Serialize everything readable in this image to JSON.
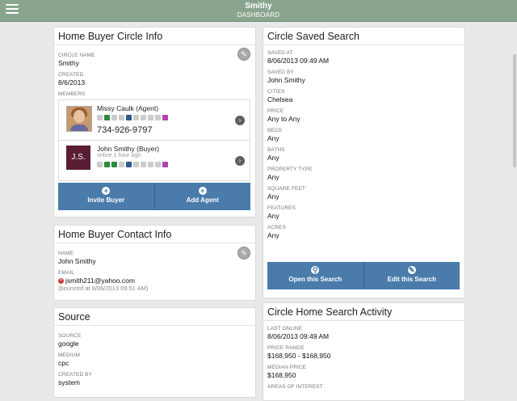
{
  "header": {
    "title": "Smithy",
    "subtitle": "DASHBOARD"
  },
  "circle_info": {
    "heading": "Home Buyer Circle Info",
    "circle_name_label": "CIRCLE NAME",
    "circle_name": "Smithy",
    "created_label": "CREATED",
    "created": "8/6/2013",
    "members_label": "MEMBERS",
    "members": [
      {
        "name": "Missy Caulk (Agent)",
        "phone": "734-926-9797"
      },
      {
        "initials": "J.S.",
        "name": "John Smithy (Buyer)",
        "status": "online 1 hour ago"
      }
    ],
    "invite_label": "Invite Buyer",
    "add_agent_label": "Add Agent"
  },
  "contact_info": {
    "heading": "Home Buyer Contact Info",
    "name_label": "NAME",
    "name": "John Smithy",
    "email_label": "EMAIL",
    "email": "jsmith211@yahoo.com",
    "bounce_note": "(bounced at 8/06/2013 09:51 AM)"
  },
  "source": {
    "heading": "Source",
    "source_label": "SOURCE",
    "source": "google",
    "medium_label": "MEDIUM",
    "medium": "cpc",
    "created_by_label": "CREATED BY",
    "created_by": "system"
  },
  "saved_search": {
    "heading": "Circle Saved Search",
    "fields": [
      {
        "label": "SAVED AT",
        "value": "8/06/2013 09:49 AM"
      },
      {
        "label": "SAVED BY",
        "value": "John Smithy"
      },
      {
        "label": "CITIES",
        "value": "Chelsea"
      },
      {
        "label": "PRICE",
        "value": "Any to Any"
      },
      {
        "label": "BEDS",
        "value": "Any"
      },
      {
        "label": "BATHS",
        "value": "Any"
      },
      {
        "label": "PROPERTY TYPE",
        "value": "Any"
      },
      {
        "label": "SQUARE FEET",
        "value": "Any"
      },
      {
        "label": "FEATURES",
        "value": "Any"
      },
      {
        "label": "ACRES",
        "value": "Any"
      }
    ],
    "open_label": "Open this Search",
    "edit_label": "Edit this Search"
  },
  "activity": {
    "heading": "Circle Home Search Activity",
    "last_online_label": "LAST ONLINE",
    "last_online": "8/06/2013 09:49 AM",
    "price_range_label": "PRICE RANGE",
    "price_range": "$168,950 - $168,950",
    "median_price_label": "MEDIAN PRICE",
    "median_price": "$168,950",
    "cut_label": "AREAS OF INTEREST"
  },
  "icons": {
    "menu": "menu-icon",
    "edit": "pencil-icon",
    "chevron": "chevron-right-icon",
    "add": "plus-icon",
    "search": "search-icon",
    "error": "error-icon"
  },
  "colors": {
    "header": "#8aa58e",
    "button": "#4a7bab",
    "initials_bg": "#5a1d33"
  }
}
